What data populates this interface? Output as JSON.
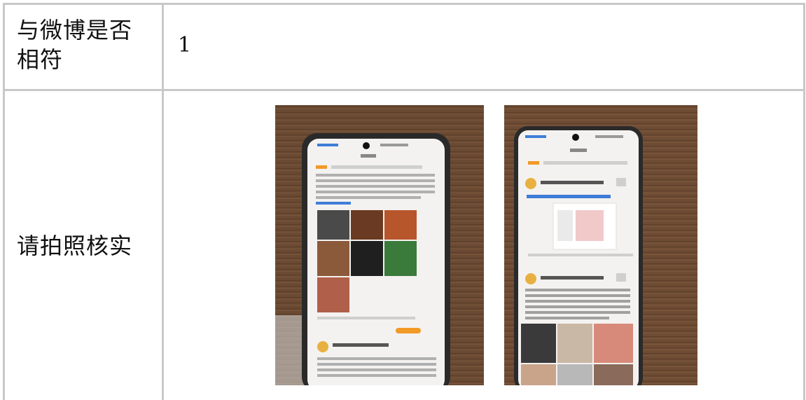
{
  "rows": [
    {
      "label": "与微博是否相符",
      "value": "1"
    },
    {
      "label": "请拍照核实"
    }
  ],
  "photos": [
    {
      "description_icon": "phone-photo-left"
    },
    {
      "description_icon": "phone-photo-right"
    }
  ],
  "colors": {
    "border": "#c8c8c8",
    "wood": "#6b4a32",
    "phone_frame": "#2a2a2a",
    "screen_bg": "#f4f2f0",
    "weibo_blue": "#3f7dd8",
    "weibo_orange": "#f29a26"
  }
}
